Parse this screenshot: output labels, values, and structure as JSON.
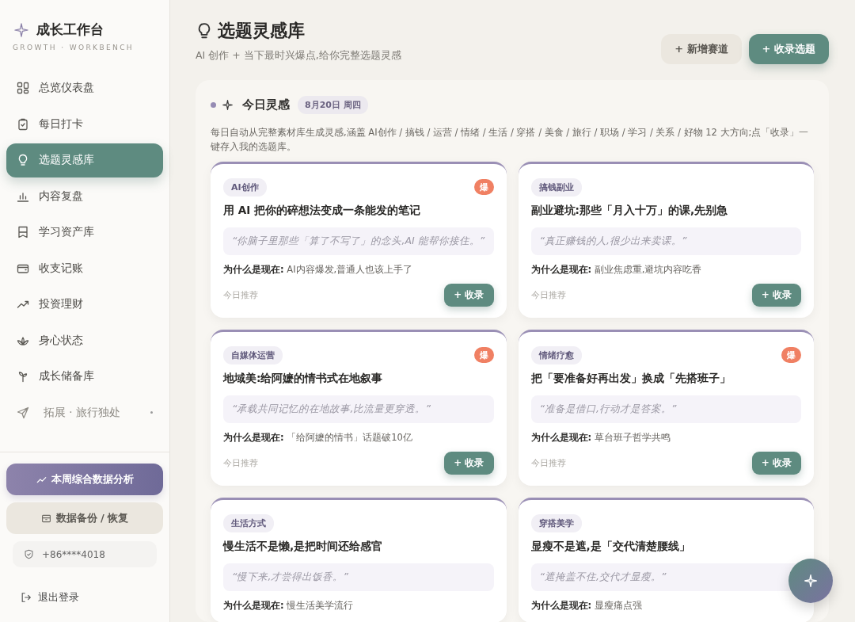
{
  "sidebar": {
    "brand": "成长工作台",
    "brand_sub": "GROWTH · WORKBENCH",
    "items": [
      {
        "label": "总览仪表盘",
        "selected": false,
        "dim": false
      },
      {
        "label": "每日打卡",
        "selected": false,
        "dim": false
      },
      {
        "label": "选题灵感库",
        "selected": true,
        "dim": false
      },
      {
        "label": "内容复盘",
        "selected": false,
        "dim": false
      },
      {
        "label": "学习资产库",
        "selected": false,
        "dim": false
      },
      {
        "label": "收支记账",
        "selected": false,
        "dim": false
      },
      {
        "label": "投资理财",
        "selected": false,
        "dim": false
      },
      {
        "label": "身心状态",
        "selected": false,
        "dim": false
      },
      {
        "label": "成长储备库",
        "selected": false,
        "dim": false
      },
      {
        "label": "拓展 · 旅行独处",
        "selected": false,
        "dim": true
      }
    ],
    "analysis_button": "本周综合数据分析",
    "backup_button": "数据备份 / 恢复",
    "phone": "+86****4018",
    "logout": "退出登录"
  },
  "header": {
    "title": "选题灵感库",
    "subtitle": "AI 创作 + 当下最时兴爆点,给你完整选题灵感",
    "buttons": [
      {
        "label": "+ 新增赛道",
        "kind": "secondary"
      },
      {
        "label": "+ 收录选题",
        "kind": "primary"
      }
    ]
  },
  "today": {
    "title": "今日灵感",
    "date": "8月20日 周四",
    "description": "每日自动从完整素材库生成灵感,涵盖 AI创作 / 搞钱 / 运营 / 情绪 / 生活 / 穿搭 / 美食 / 旅行 / 职场 / 学习 / 关系 / 好物 12 大方向;点「收录」一键存入我的选题库。",
    "cards": [
      {
        "tag": "AI创作",
        "badge": "爆",
        "title": "用 AI 把你的碎想法变成一条能发的笔记",
        "quote": "“你脑子里那些「算了不写了」的念头,AI 能帮你接住。”",
        "why_label": "为什么是现在:",
        "why": "AI内容爆发,普通人也该上手了",
        "footer": "今日推荐",
        "button": "+ 收录"
      },
      {
        "tag": "搞钱副业",
        "title": "副业避坑:那些「月入十万」的课,先别急",
        "quote": "“真正赚钱的人,很少出来卖课。”",
        "why_label": "为什么是现在:",
        "why": "副业焦虑重,避坑内容吃香",
        "footer": "今日推荐",
        "button": "+ 收录"
      },
      {
        "tag": "自媒体运营",
        "badge": "爆",
        "title": "地域美:给阿嬷的情书式在地叙事",
        "quote": "“承载共同记忆的在地故事,比流量更穿透。”",
        "why_label": "为什么是现在:",
        "why": "「给阿嬷的情书」话题破10亿",
        "footer": "今日推荐",
        "button": "+ 收录"
      },
      {
        "tag": "情绪疗愈",
        "badge": "爆",
        "title": "把「要准备好再出发」换成「先搭班子」",
        "quote": "“准备是借口,行动才是答案。”",
        "why_label": "为什么是现在:",
        "why": "草台班子哲学共鸣",
        "footer": "今日推荐",
        "button": "+ 收录"
      },
      {
        "tag": "生活方式",
        "title": "慢生活不是懒,是把时间还给感官",
        "quote": "“慢下来,才尝得出饭香。”",
        "why_label": "为什么是现在:",
        "why": "慢生活美学流行"
      },
      {
        "tag": "穿搭美学",
        "title": "显瘦不是遮,是「交代清楚腰线」",
        "quote": "“遮掩盖不住,交代才显瘦。”",
        "why_label": "为什么是现在:",
        "why": "显瘦痛点强"
      }
    ]
  }
}
